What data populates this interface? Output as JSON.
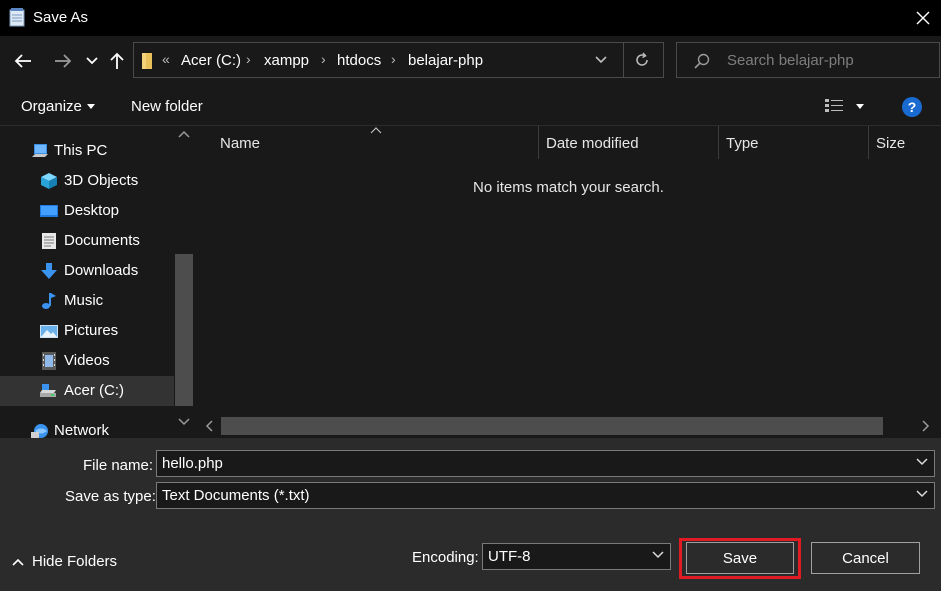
{
  "window": {
    "title": "Save As",
    "icon": "notepad-icon",
    "close_icon": "close-icon"
  },
  "navigation": {
    "back_icon": "arrow-left-icon",
    "forward_icon": "arrow-right-icon",
    "recent_icon": "chevron-down-icon",
    "up_icon": "arrow-up-icon"
  },
  "address_bar": {
    "overflow": "«",
    "breadcrumbs": [
      "Acer (C:)",
      "xampp",
      "htdocs",
      "belajar-php"
    ],
    "separator": "›"
  },
  "search": {
    "placeholder": "Search belajar-php"
  },
  "toolbar": {
    "organize_label": "Organize",
    "new_folder_label": "New folder",
    "help_label": "?"
  },
  "sidebar": {
    "items": [
      {
        "label": "This PC",
        "icon": "computer-icon"
      },
      {
        "label": "3D Objects",
        "icon": "cube-icon"
      },
      {
        "label": "Desktop",
        "icon": "desktop-icon"
      },
      {
        "label": "Documents",
        "icon": "document-icon"
      },
      {
        "label": "Downloads",
        "icon": "download-icon"
      },
      {
        "label": "Music",
        "icon": "music-icon"
      },
      {
        "label": "Pictures",
        "icon": "pictures-icon"
      },
      {
        "label": "Videos",
        "icon": "video-icon"
      },
      {
        "label": "Acer (C:)",
        "icon": "drive-icon"
      },
      {
        "label": "Network",
        "icon": "network-icon"
      }
    ]
  },
  "file_list": {
    "columns": [
      "Name",
      "Date modified",
      "Type",
      "Size"
    ],
    "empty_message": "No items match your search."
  },
  "form": {
    "file_name_label": "File name:",
    "file_name_value": "hello.php",
    "save_type_label": "Save as type:",
    "save_type_value": "Text Documents (*.txt)",
    "encoding_label": "Encoding:",
    "encoding_value": "UTF-8"
  },
  "footer": {
    "hide_folders_label": "Hide Folders",
    "save_label": "Save",
    "cancel_label": "Cancel"
  },
  "colors": {
    "highlight": "#e01b24",
    "help": "#1a6bd1",
    "background": "#191919",
    "panel": "#2b2b2b"
  }
}
